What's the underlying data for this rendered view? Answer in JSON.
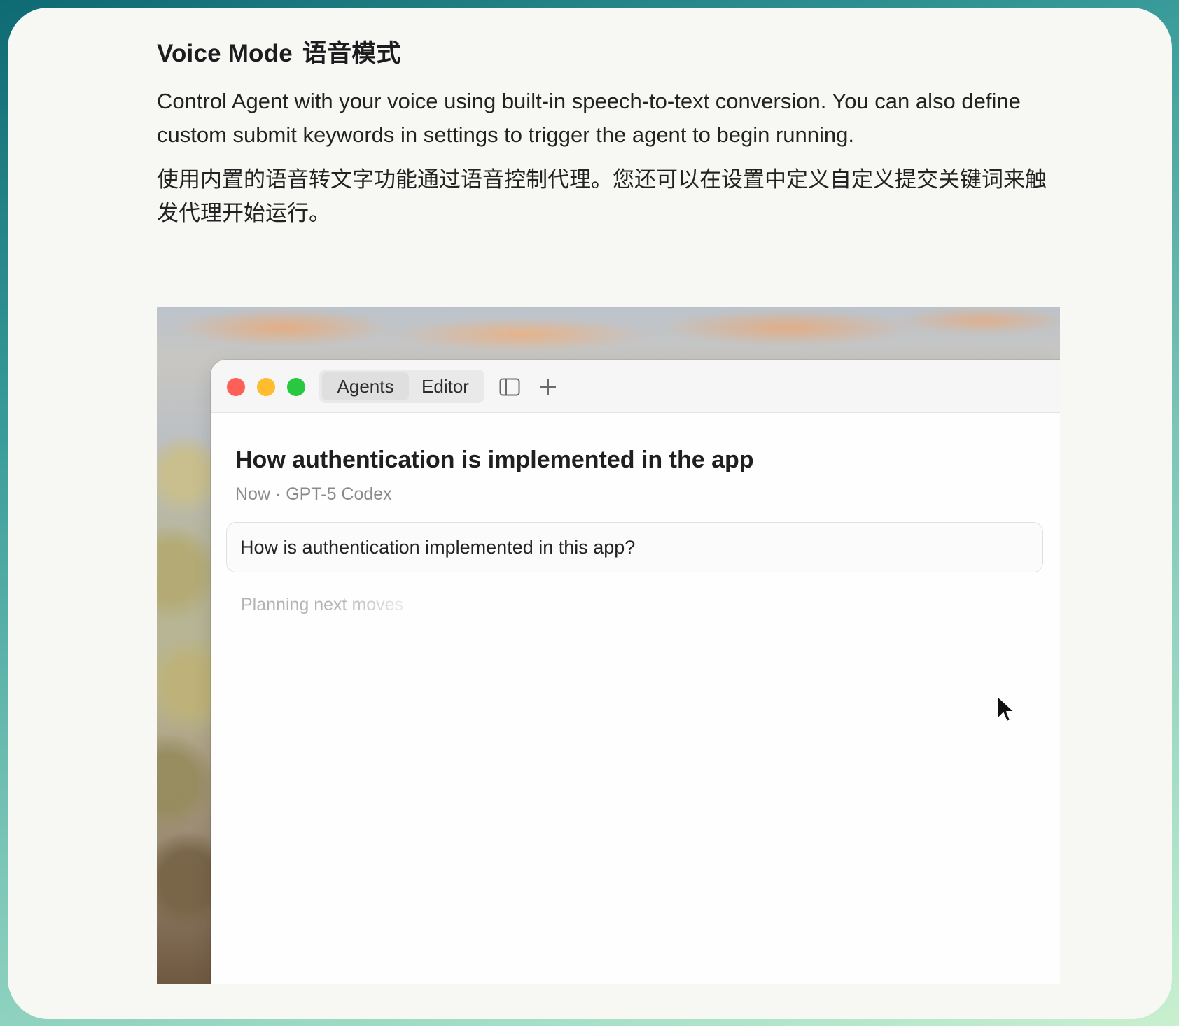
{
  "section": {
    "title_en": "Voice Mode",
    "title_zh": "语音模式",
    "description_en": "Control Agent with your voice using built-in speech-to-text conversion. You can also define custom submit keywords in settings to trigger the agent to begin running.",
    "description_zh": "使用内置的语音转文字功能通过语音控制代理。您还可以在设置中定义自定义提交关键词来触发代理开始运行。"
  },
  "app_window": {
    "tabs": [
      {
        "label": "Agents",
        "selected": true
      },
      {
        "label": "Editor",
        "selected": false
      }
    ],
    "toolbar_icons": [
      "sidebar-toggle-icon",
      "plus-icon"
    ],
    "conversation": {
      "title": "How authentication is implemented in the app",
      "meta": "Now · GPT-5 Codex",
      "prompt": "How is authentication implemented in this app?",
      "status": "Planning next moves"
    }
  },
  "colors": {
    "close": "#fe5f57",
    "minimize": "#febc2e",
    "zoom": "#28c840",
    "card_background": "#f7f7f4"
  }
}
